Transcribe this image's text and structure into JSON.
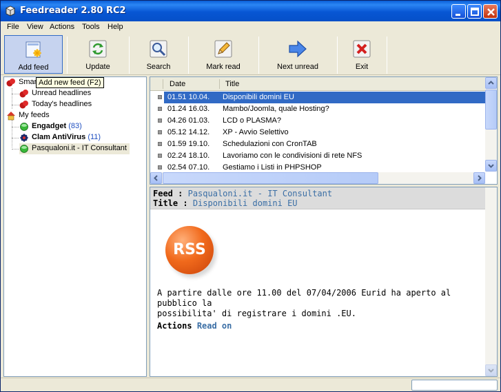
{
  "window": {
    "title": "Feedreader 2.80 RC2"
  },
  "menu": [
    "File",
    "View",
    "Actions",
    "Tools",
    "Help"
  ],
  "toolbar": {
    "add_feed": "Add feed",
    "update": "Update",
    "search": "Search",
    "mark_read": "Mark read",
    "next_unread": "Next unread",
    "exit": "Exit"
  },
  "tree": {
    "smart_prefix": "Smar",
    "tooltip": "Add new feed (F2)",
    "unread": "Unread headlines",
    "today": "Today's headlines",
    "my_feeds": "My feeds",
    "engadget": "Engadget",
    "engadget_count": "(83)",
    "clam": "Clam AntiVirus",
    "clam_count": "(11)",
    "pasqualoni": "Pasqualoni.it - IT Consultant"
  },
  "list": {
    "col_date": "Date",
    "col_title": "Title",
    "rows": [
      {
        "date": "01.51 10.04.",
        "title": "Disponibili domini EU"
      },
      {
        "date": "01.24 16.03.",
        "title": "Mambo/Joomla, quale Hosting?"
      },
      {
        "date": "04.26 01.03.",
        "title": "LCD o PLASMA?"
      },
      {
        "date": "05.12 14.12.",
        "title": "XP - Avvio Selettivo"
      },
      {
        "date": "01.59 19.10.",
        "title": "Schedulazioni con CronTAB"
      },
      {
        "date": "02.24 18.10.",
        "title": "Lavoriamo con le condivisioni di rete NFS"
      },
      {
        "date": "02.54 07.10.",
        "title": "Gestiamo i Listi in PHPSHOP"
      }
    ]
  },
  "reader": {
    "feed_key": "Feed :",
    "feed_value": "Pasqualoni.it - IT Consultant",
    "title_key": "Title :",
    "title_value": "Disponibili domini EU",
    "rss_logo": "RSS",
    "body_line1": "A partire dalle ore 11.00 del 07/04/2006 Eurid ha aperto al pubblico la",
    "body_line2": "possibilita' di registrare i domini .EU.",
    "actions_key": "Actions",
    "actions_link": "Read on"
  },
  "colors": {
    "selection": "#316ac5",
    "titlebar": "#0756d4",
    "link": "#3a6ea5",
    "rss": "#f16a1c"
  }
}
